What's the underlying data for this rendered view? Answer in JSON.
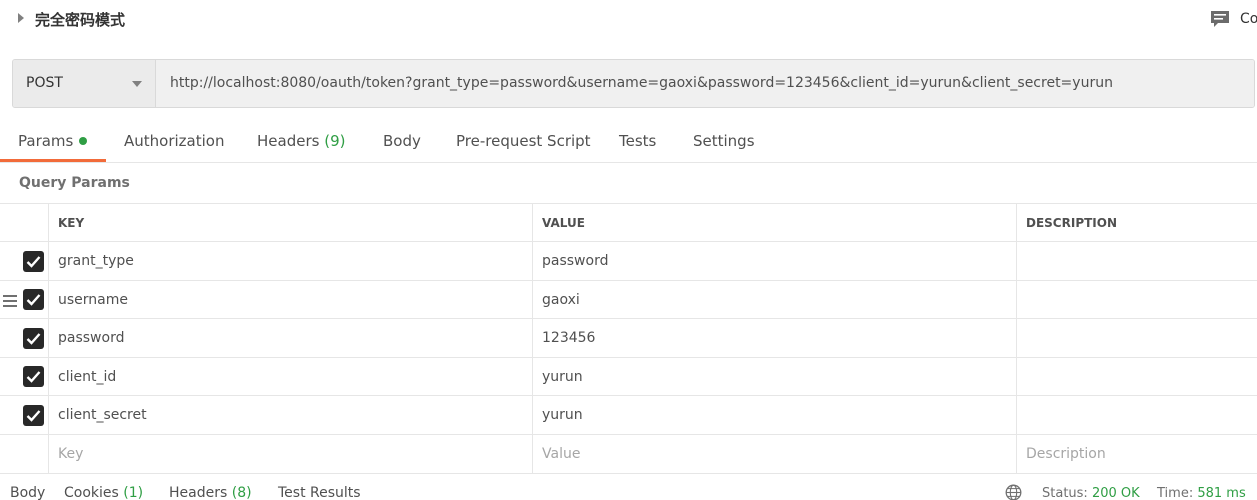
{
  "title": {
    "request_name": "完全密码模式",
    "comments_label": "Co"
  },
  "request": {
    "method": "POST",
    "url": "http://localhost:8080/oauth/token?grant_type=password&username=gaoxi&password=123456&client_id=yurun&client_secret=yurun"
  },
  "tabs": [
    {
      "label": "Params",
      "count": ""
    },
    {
      "label": "Authorization",
      "count": ""
    },
    {
      "label": "Headers",
      "count": "(9)"
    },
    {
      "label": "Body",
      "count": ""
    },
    {
      "label": "Pre-request Script",
      "count": ""
    },
    {
      "label": "Tests",
      "count": ""
    },
    {
      "label": "Settings",
      "count": ""
    }
  ],
  "query_params": {
    "title": "Query Params",
    "columns": [
      "KEY",
      "VALUE",
      "DESCRIPTION"
    ],
    "rows": [
      {
        "key": "grant_type",
        "value": "password",
        "description": "",
        "checked": true
      },
      {
        "key": "username",
        "value": "gaoxi",
        "description": "",
        "checked": true
      },
      {
        "key": "password",
        "value": "123456",
        "description": "",
        "checked": true
      },
      {
        "key": "client_id",
        "value": "yurun",
        "description": "",
        "checked": true
      },
      {
        "key": "client_secret",
        "value": "yurun",
        "description": "",
        "checked": true
      }
    ],
    "placeholders": {
      "key": "Key",
      "value": "Value",
      "description": "Description"
    }
  },
  "response": {
    "tabs": [
      {
        "label": "Body",
        "count": ""
      },
      {
        "label": "Cookies",
        "count": "(1)"
      },
      {
        "label": "Headers",
        "count": "(8)"
      },
      {
        "label": "Test Results",
        "count": ""
      }
    ],
    "status_label": "Status:",
    "status_value": "200 OK",
    "time_label": "Time:",
    "time_value": "581 ms"
  },
  "colors": {
    "accent": "#f26b3a",
    "success": "#2f9e44"
  }
}
